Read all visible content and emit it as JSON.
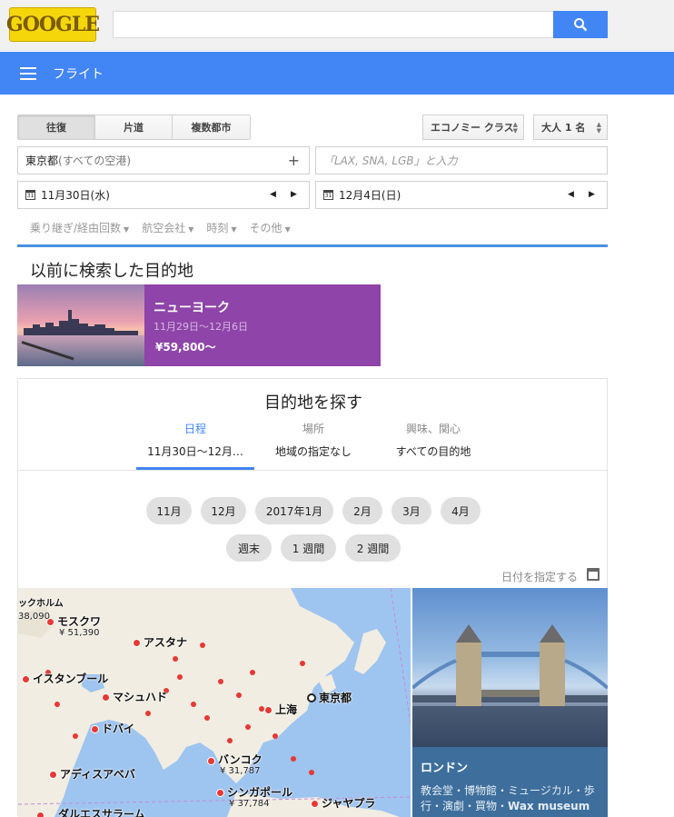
{
  "logo": {
    "text": "GOOGLE"
  },
  "search": {
    "value": "",
    "button_icon": "search-icon"
  },
  "header": {
    "title": "フライト"
  },
  "trip_types": [
    "往復",
    "片道",
    "複数都市"
  ],
  "cabin_class": "エコノミー クラス",
  "passengers": "大人 1 名",
  "origin": {
    "city": "東京都",
    "detail": " (すべての空港)"
  },
  "destination": {
    "placeholder": "「LAX, SNA, LGB」と入力"
  },
  "depart_date": "11月30日(水)",
  "return_date": "12月4日(日)",
  "filters": [
    "乗り継ぎ/経由回数",
    "航空会社",
    "時刻",
    "その他"
  ],
  "recent": {
    "title": "以前に検索した目的地",
    "card": {
      "name": "ニューヨーク",
      "dates": "11月29日〜12月6日",
      "price": "¥59,800〜"
    }
  },
  "explore": {
    "title": "目的地を探す",
    "tabs": [
      {
        "label": "日程",
        "value": "11月30日〜12月…"
      },
      {
        "label": "場所",
        "value": "地域の指定なし"
      },
      {
        "label": "興味、関心",
        "value": "すべての目的地"
      }
    ],
    "months": [
      "11月",
      "12月",
      "2017年1月",
      "2月",
      "3月",
      "4月"
    ],
    "durations": [
      "週末",
      "1 週間",
      "2 週間"
    ],
    "specify_date": "日付を指定する"
  },
  "map": {
    "labels": [
      "ックホルム",
      "モスクワ",
      "アスタナ",
      "イスタンブール",
      "マシュハド",
      "ドバイ",
      "上海",
      "東京都",
      "アディスアベバ",
      "バンコク",
      "シンガポール",
      "ジャヤプラ",
      "ダルエスサラーム"
    ],
    "prices": [
      "38,090",
      "¥ 51,390",
      "¥ 31,787",
      "¥ 37,784"
    ]
  },
  "featured": {
    "name": "ロンドン",
    "tags": "教会堂・博物館・ミュージカル・歩行・演劇・買物・",
    "tags_bold": "Wax museum"
  }
}
